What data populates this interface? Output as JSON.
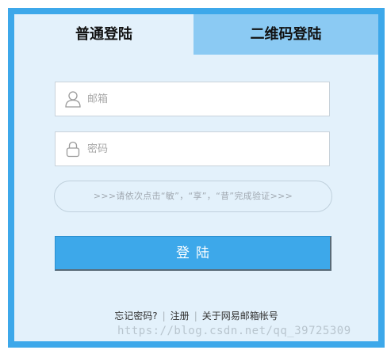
{
  "tabs": {
    "normal_label": "普通登陆",
    "qrcode_label": "二维码登陆"
  },
  "form": {
    "email_placeholder": "邮箱",
    "password_placeholder": "密码",
    "captcha_text": ">>>请依次点击“敏”，“享”，“昔”完成验证>>>",
    "login_label": "登陆"
  },
  "footer": {
    "forgot_label": "忘记密码?",
    "register_label": "注册",
    "about_label": "关于网易邮箱帐号"
  },
  "watermark": "https://blog.csdn.net/qq_39725309",
  "colors": {
    "accent": "#3da8ea",
    "tab_inactive": "#8bcaf3",
    "panel_bg": "#e3f1fb"
  },
  "icons": {
    "email": "user-icon",
    "password": "lock-icon"
  }
}
